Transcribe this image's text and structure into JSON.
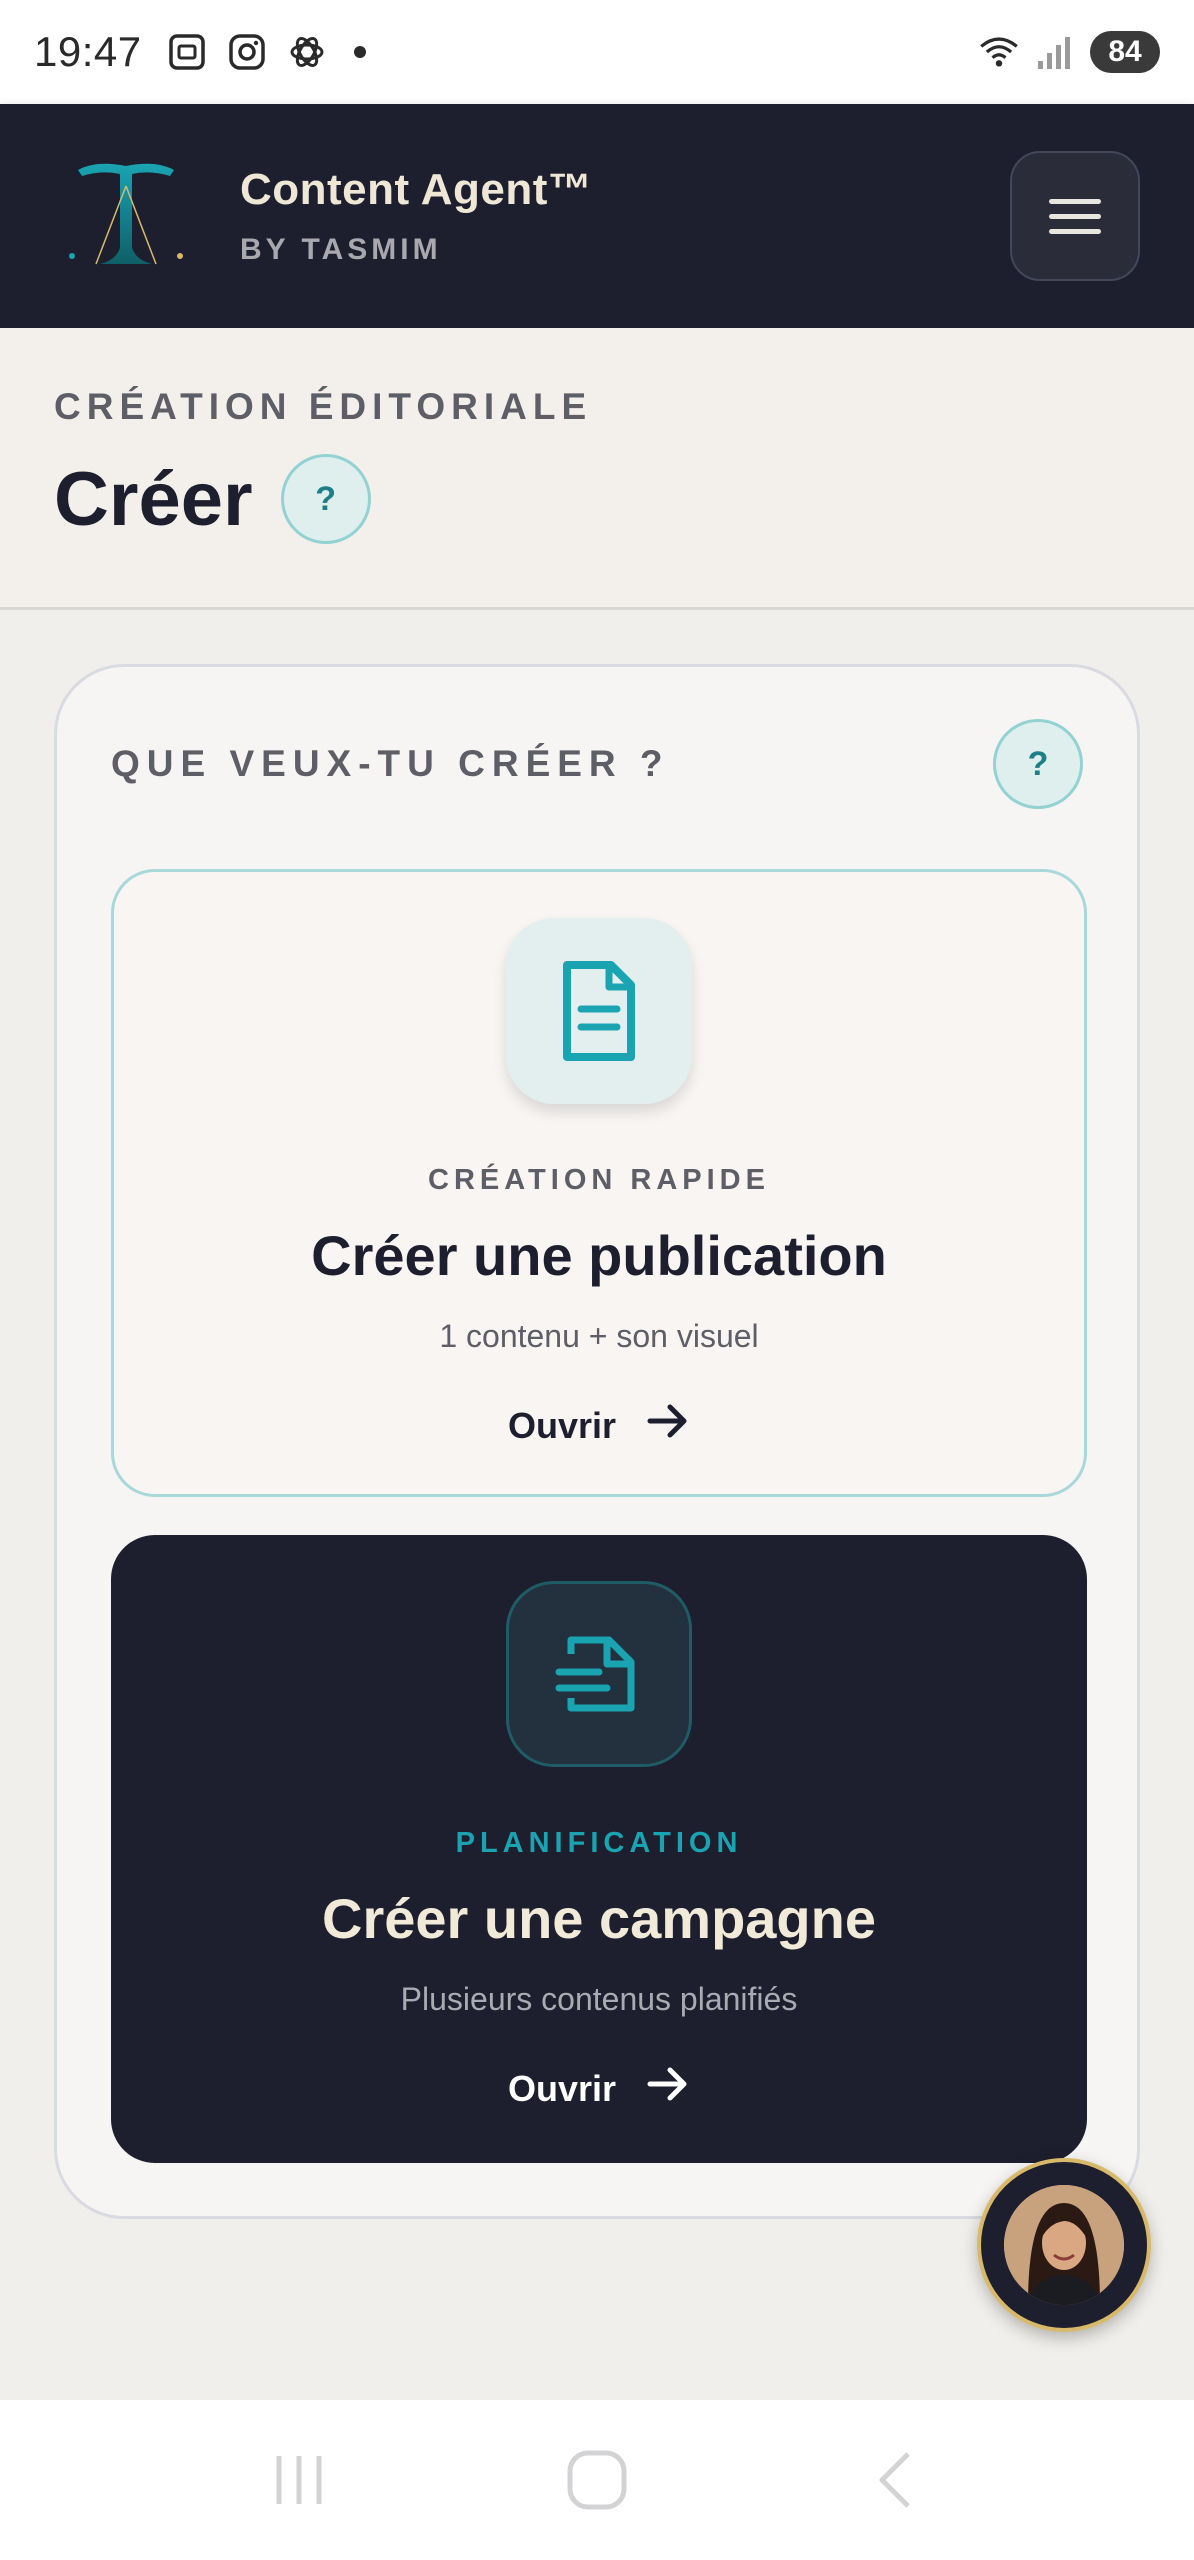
{
  "status_bar": {
    "time": "19:47",
    "battery": "84",
    "left_icons": [
      "screenshot-icon",
      "instagram-icon",
      "openai-icon"
    ],
    "right_icons": [
      "wifi-icon",
      "signal-icon"
    ]
  },
  "header": {
    "brand_title": "Content Agent™",
    "brand_subtitle": "BY TASMIM",
    "logo_icon": "tasmim-logo-icon",
    "menu_icon": "hamburger-menu-icon"
  },
  "page": {
    "eyebrow": "CRÉATION ÉDITORIALE",
    "title": "Créer",
    "help_label": "?"
  },
  "section": {
    "label": "QUE VEUX-TU CRÉER ?",
    "help_label": "?"
  },
  "options": [
    {
      "kicker": "CRÉATION RAPIDE",
      "title": "Créer une publication",
      "description": "1 contenu + son visuel",
      "cta": "Ouvrir",
      "icon": "document-icon"
    },
    {
      "kicker": "PLANIFICATION",
      "title": "Créer une campagne",
      "description": "Plusieurs contenus planifiés",
      "cta": "Ouvrir",
      "icon": "campaign-document-icon"
    }
  ],
  "colors": {
    "navy": "#1d1f2e",
    "teal": "#1aa4b2",
    "cream": "#f1ead9",
    "gold": "#d8b96a"
  },
  "navigation_bar": [
    "recents-icon",
    "home-icon",
    "back-icon"
  ]
}
